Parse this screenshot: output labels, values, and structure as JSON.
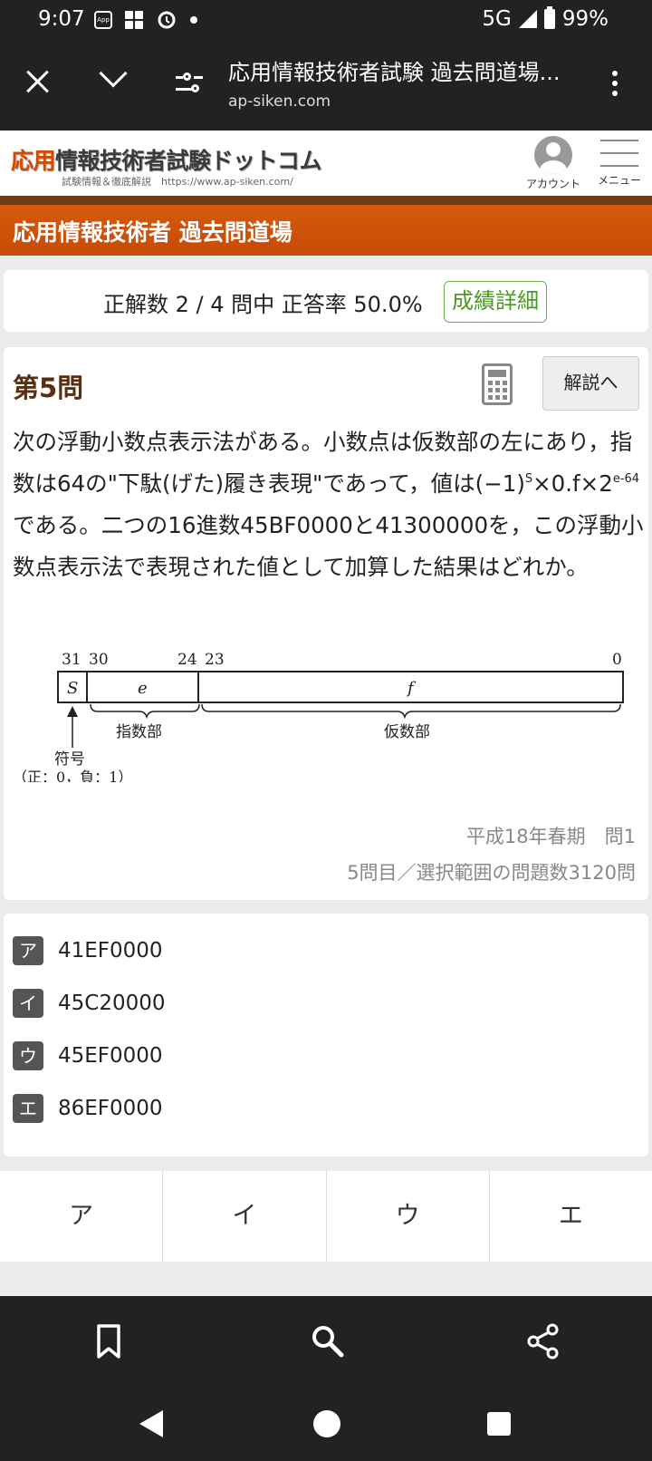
{
  "status": {
    "time": "9:07",
    "network": "5G",
    "battery": "99%",
    "app_badge": "App"
  },
  "browser": {
    "title": "応用情報技術者試験 過去問道場...",
    "url": "ap-siken.com"
  },
  "site": {
    "logo_red": "応用",
    "logo_rest": "情報技術者試験ドットコム",
    "logo_sub": "試験情報＆徹底解説　https://www.ap-siken.com/",
    "account_label": "アカウント",
    "menu_label": "メニュー",
    "banner": "応用情報技術者 過去問道場"
  },
  "score": {
    "text": "正解数 2 / 4 問中 正答率 50.0%",
    "details_button": "成績詳細"
  },
  "question": {
    "title": "第5問",
    "explain_button": "解説へ",
    "text_part1": "次の浮動小数点表示法がある。小数点は仮数部の左にあり，指数は64の\"下駄(げた)履き表現\"であって，値は(−1)",
    "sup1": "S",
    "text_part2": "×0.f×2",
    "sup2": "e-64",
    "text_part3": "である。二つの16進数45BF0000と41300000を，この浮動小数点表示法で表現された値として加算した結果はどれか。",
    "source": "平成18年春期　問1",
    "count": "5問目／選択範囲の問題数3120問"
  },
  "diagram": {
    "bits": [
      "31",
      "30",
      "24",
      "23",
      "0"
    ],
    "fields": [
      "S",
      "e",
      "f"
    ],
    "labels": {
      "exponent": "指数部",
      "mantissa": "仮数部",
      "sign": "符号",
      "sign_note": "（正：0，負：1）"
    }
  },
  "choices": [
    {
      "label": "ア",
      "value": "41EF0000"
    },
    {
      "label": "イ",
      "value": "45C20000"
    },
    {
      "label": "ウ",
      "value": "45EF0000"
    },
    {
      "label": "エ",
      "value": "86EF0000"
    }
  ],
  "answers": [
    "ア",
    "イ",
    "ウ",
    "エ"
  ],
  "icons": {
    "toolbar": [
      "bookmark-icon",
      "search-icon",
      "share-icon"
    ],
    "nav": [
      "back-icon",
      "home-icon",
      "recents-icon"
    ],
    "accent": "#c94b05",
    "success": "#4a9a22"
  }
}
